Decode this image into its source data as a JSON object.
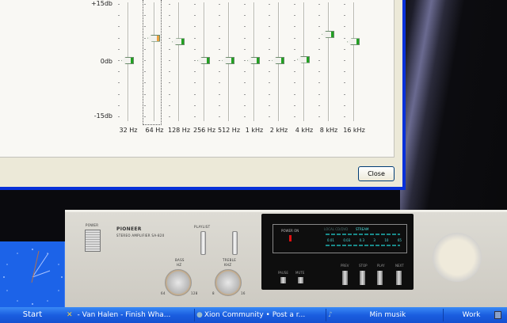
{
  "equalizer": {
    "db_labels": {
      "top": "+15db",
      "mid": "0db",
      "bottom": "-15db"
    },
    "range": [
      -15,
      15
    ],
    "bands": [
      {
        "label": "32 Hz",
        "value": 0
      },
      {
        "label": "64 Hz",
        "value": 6
      },
      {
        "label": "128 Hz",
        "value": 5
      },
      {
        "label": "256 Hz",
        "value": 0
      },
      {
        "label": "512 Hz",
        "value": 0
      },
      {
        "label": "1 kHz",
        "value": 0
      },
      {
        "label": "2 kHz",
        "value": 0
      },
      {
        "label": "4 kHz",
        "value": 0.3
      },
      {
        "label": "8 kHz",
        "value": 7
      },
      {
        "label": "16 kHz",
        "value": 5
      }
    ],
    "selected_band": 1,
    "close_label": "Close"
  },
  "amplifier": {
    "power": "POWER",
    "brand": "PIONEER",
    "model": "STEREO AMPLIFIER SA-820",
    "playlist": "PLAYLIST",
    "bass": "BASS",
    "bass_unit": "HZ",
    "bass_min": "64",
    "bass_max": "128",
    "treble": "TREBLE",
    "treble_unit": "KHZ",
    "treble_min": "8",
    "treble_max": "16",
    "power_on": "POWER ON",
    "source": "LOCAL CD/DVD",
    "stream": "STREAM",
    "scale": [
      "0.01",
      "0.03",
      "0.3",
      "3",
      "10",
      "65"
    ],
    "pause": "PAUSE",
    "mute": "MUTE",
    "prev": "PREV",
    "stop": "STOP",
    "play": "PLAY",
    "next": "NEXT"
  },
  "taskbar": {
    "start": "Start",
    "tasks": [
      "- Van Halen - Finish Wha...",
      "Xion Community • Post a r...",
      "Min musik",
      "Work"
    ]
  }
}
